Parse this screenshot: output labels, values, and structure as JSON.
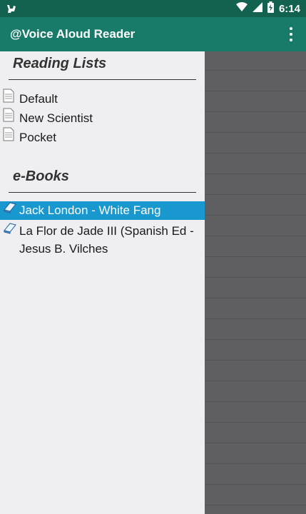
{
  "status_bar": {
    "time": "6:14",
    "icons": [
      "app-notification-icon",
      "wifi-icon",
      "signal-icon",
      "battery-icon"
    ]
  },
  "app_bar": {
    "title": "@Voice Aloud Reader",
    "menu_icon": "more-vert-icon"
  },
  "drawer": {
    "reading_lists": {
      "header": "Reading Lists",
      "items": [
        {
          "label": "Default",
          "icon": "document-icon"
        },
        {
          "label": "New Scientist",
          "icon": "document-icon"
        },
        {
          "label": "Pocket",
          "icon": "document-icon"
        }
      ]
    },
    "ebooks": {
      "header": "e-Books",
      "items": [
        {
          "label": "Jack London - White Fang",
          "icon": "book-icon",
          "selected": true
        },
        {
          "label": "La Flor de Jade III (Spanish Ed - Jesus B. Vilches",
          "icon": "book-icon",
          "selected": false
        }
      ]
    }
  },
  "colors": {
    "status_bar": "#13614f",
    "app_bar": "#187b6a",
    "drawer_bg": "#efeef1",
    "selected": "#1998d0",
    "scrim": "#5f5e61"
  }
}
